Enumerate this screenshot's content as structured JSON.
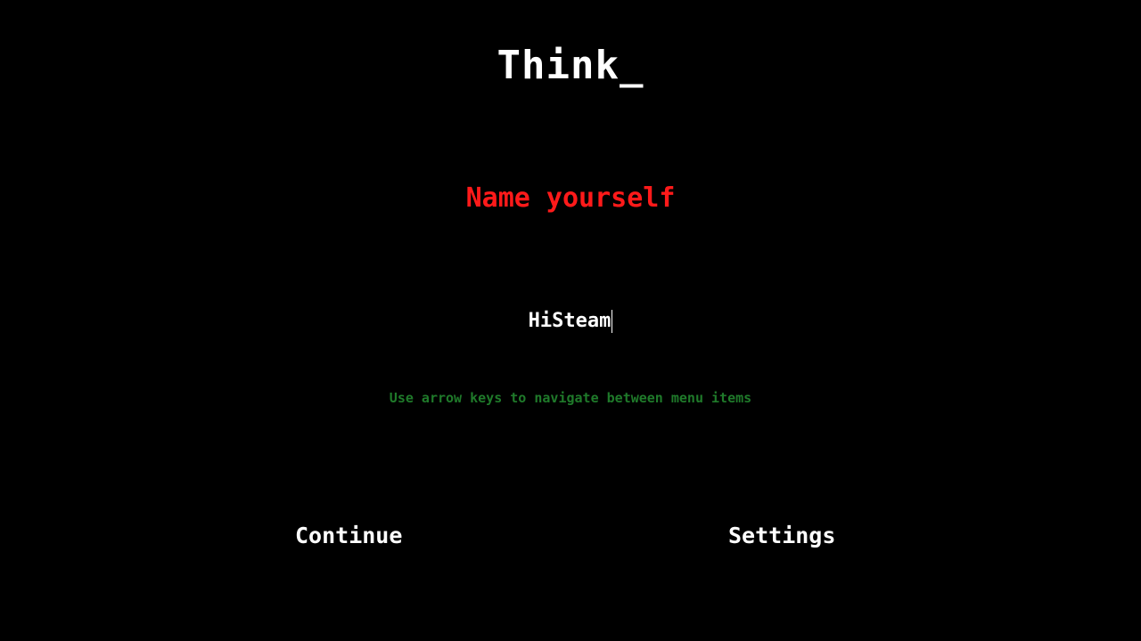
{
  "game": {
    "title": "Think_"
  },
  "name_screen": {
    "prompt": "Name yourself",
    "name_value": "HiSteam",
    "hint": "Use arrow keys to navigate between menu items"
  },
  "menu": {
    "continue_label": "Continue",
    "settings_label": "Settings"
  },
  "colors": {
    "background": "#000000",
    "text": "#ffffff",
    "prompt": "#ff1a1a",
    "hint": "#1f7a2a"
  }
}
